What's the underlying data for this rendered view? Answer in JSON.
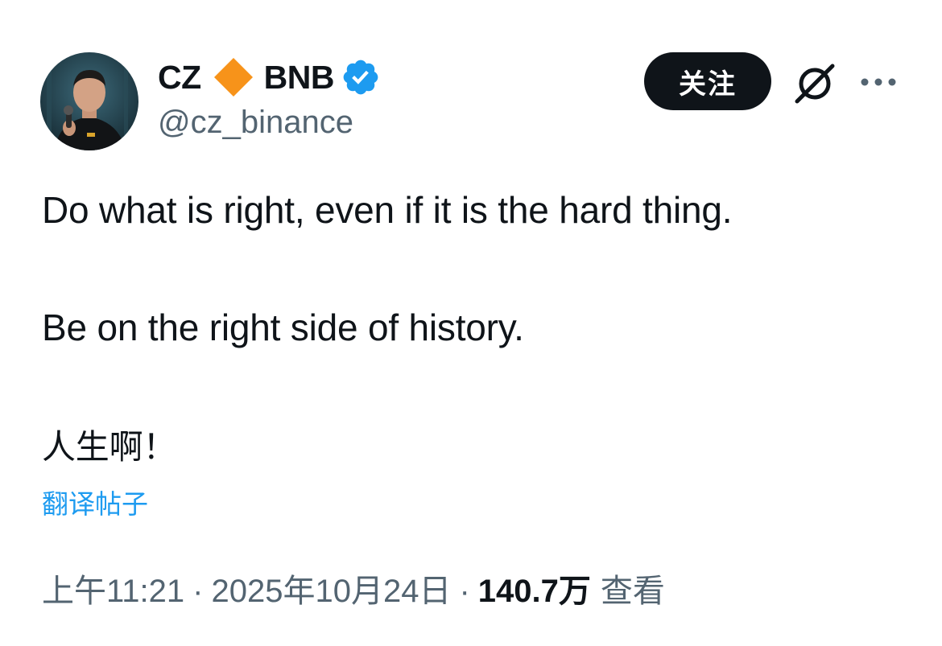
{
  "author": {
    "name_prefix": "CZ",
    "name_suffix": "BNB",
    "handle": "@cz_binance",
    "diamond_color": "#f7931a",
    "verified_color": "#1d9bf0",
    "avatar_icon": "profile-photo",
    "badge_icon": "verified-badge-icon"
  },
  "actions": {
    "follow_label": "关注",
    "grok_icon": "grok-icon",
    "more_icon": "more-horizontal-icon"
  },
  "tweet": {
    "lines": [
      "Do what is right, even if it is the hard thing.",
      "Be on the right side of history.",
      "人生啊！"
    ],
    "translate_label": "翻译帖子"
  },
  "meta": {
    "time": "上午11:21",
    "separator": "·",
    "date": "2025年10月24日",
    "views_count": "140.7万",
    "views_label": "查看"
  }
}
